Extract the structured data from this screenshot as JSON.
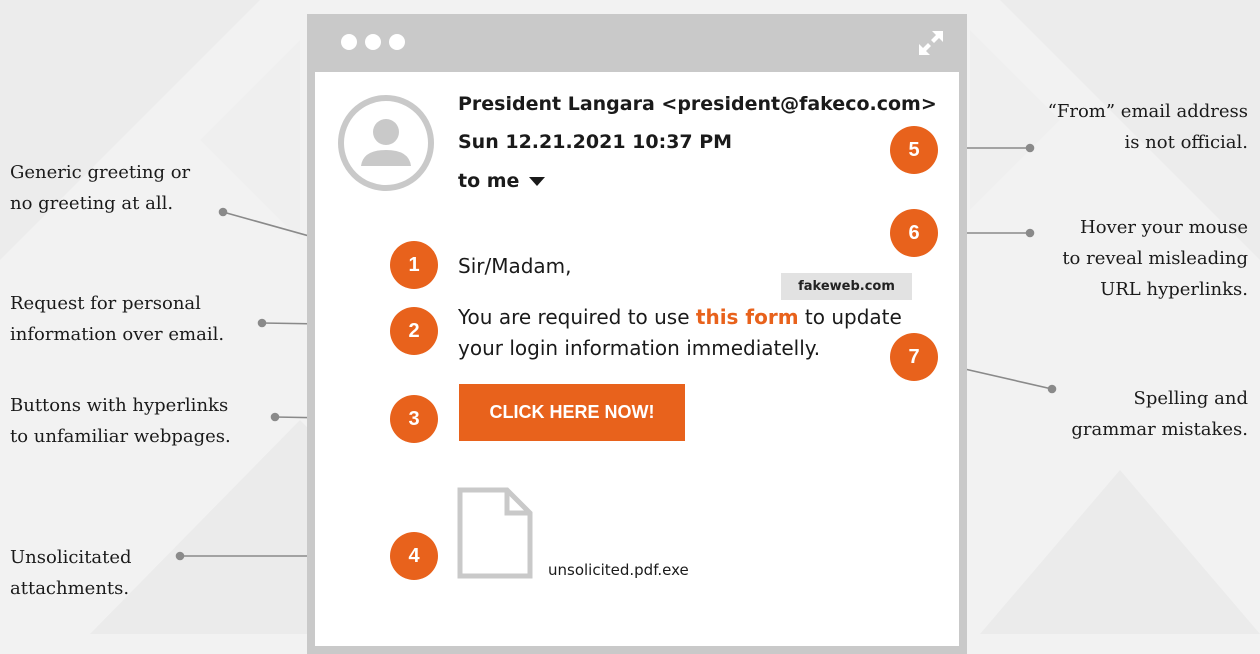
{
  "colors": {
    "accent": "#e8621c",
    "frame": "#c9c9c9",
    "background": "#f2f2f2"
  },
  "window": {
    "controls": [
      "dot",
      "dot",
      "dot"
    ],
    "expand_icon": "expand-arrows-icon"
  },
  "email": {
    "avatar_icon": "user-avatar-icon",
    "sender": "President Langara <president@fakeco.com>",
    "datetime": "Sun 12.21.2021 10:37 PM",
    "recipient": "to me",
    "recipient_icon": "caret-down-icon",
    "greeting": "Sir/Madam,",
    "body_before_link": "You are required to use ",
    "link_text": "this form",
    "body_after_link": " to update your login information immediatelly.",
    "hover_url": "fakeweb.com",
    "button_label": "CLICK HERE NOW!",
    "attachment_icon": "document-icon",
    "attachment_name": "unsolicited.pdf.exe"
  },
  "callouts": [
    {
      "number": "1",
      "text": "Generic greeting or\nno greeting at all."
    },
    {
      "number": "2",
      "text": "Request for personal\ninformation over email."
    },
    {
      "number": "3",
      "text": "Buttons with hyperlinks\nto unfamiliar webpages."
    },
    {
      "number": "4",
      "text": "Unsolicitated\nattachments."
    },
    {
      "number": "5",
      "text": "“From” email address\nis not official."
    },
    {
      "number": "6",
      "text": "Hover your mouse\nto reveal misleading\nURL hyperlinks."
    },
    {
      "number": "7",
      "text": "Spelling and\ngrammar mistakes."
    }
  ]
}
